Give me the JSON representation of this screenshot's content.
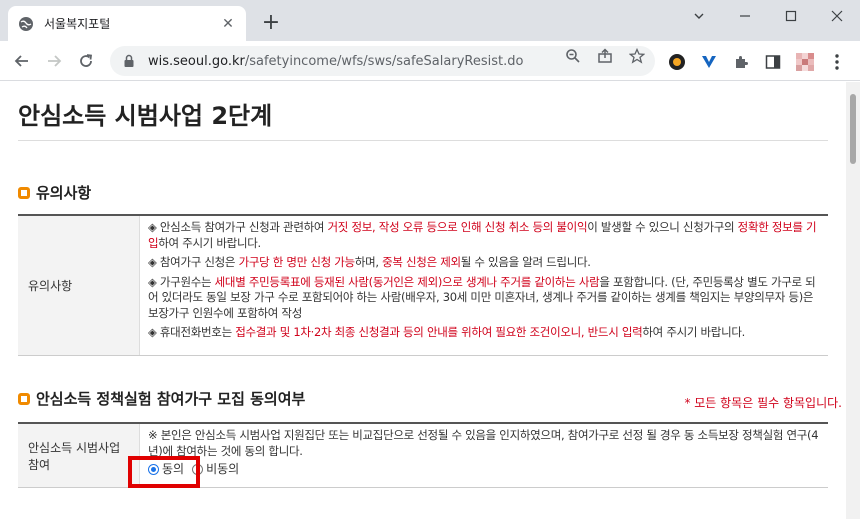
{
  "browser": {
    "tab_title": "서울복지포털",
    "new_tab_symbol": "+",
    "url_host": "wis.seoul.go.kr",
    "url_path": "/safetyincome/wfs/sws/safeSalaryResist.do"
  },
  "page": {
    "title": "안심소득 시범사업 2단계",
    "section1": {
      "heading": "유의사항",
      "row_label": "유의사항",
      "notes": [
        {
          "parts": [
            {
              "t": "◈ 안심소득 참여가구 신청과 관련하여 ",
              "red": false
            },
            {
              "t": "거짓 정보, 작성 오류 등으로 인해 신청 취소 등의 불이익",
              "red": true
            },
            {
              "t": "이 발생할 수 있으니 신청가구의 ",
              "red": false
            },
            {
              "t": "정확한 정보를 기입",
              "red": true
            },
            {
              "t": "하여 주시기 바랍니다.",
              "red": false
            }
          ]
        },
        {
          "parts": [
            {
              "t": "◈ 참여가구 신청은 ",
              "red": false
            },
            {
              "t": "가구당 한 명만 신청 가능",
              "red": true
            },
            {
              "t": "하며, ",
              "red": false
            },
            {
              "t": "중복 신청은 제외",
              "red": true
            },
            {
              "t": "될 수 있음을 알려 드립니다.",
              "red": false
            }
          ]
        },
        {
          "parts": [
            {
              "t": "◈ 가구원수는 ",
              "red": false
            },
            {
              "t": "세대별 주민등록표에 등재된 사람(동거인은 제외)으로 생계나 주거를 같이하는 사람",
              "red": true
            },
            {
              "t": "을 포함합니다. (단, 주민등록상 별도 가구로 되어 있더라도 동일 보장 가구 수로 포함되어야 하는 사람(배우자, 30세 미만 미혼자녀, 생계나 주거를 같이하는 생계를 책임지는 부양의무자 등)은 보장가구 인원수에 포함하여 작성",
              "red": false
            }
          ]
        },
        {
          "parts": [
            {
              "t": "◈ 휴대전화번호는 ",
              "red": false
            },
            {
              "t": "접수결과 및 1차·2차 최종 신청결과 등의 안내를 위하여 필요한 조건이오니, 반드시 입력",
              "red": true
            },
            {
              "t": "하여 주시기 바랍니다.",
              "red": false
            }
          ]
        }
      ]
    },
    "section2": {
      "heading": "안심소득 정책실험 참여가구 모집 동의여부",
      "required_note": "* 모든 항목은 필수 항목입니다.",
      "row_label_line1": "안심소득 시범사업",
      "row_label_line2": "참여",
      "consent_text": "※ 본인은 안심소득 시범사업 지원집단 또는 비교집단으로 선정될 수 있음을 인지하였으며, 참여가구로 선정 될 경우 동 소득보장 정책실험 연구(4년)에 참여하는 것에 동의 합니다.",
      "option_agree": "동의",
      "option_disagree": "비동의",
      "selected": "동의"
    }
  },
  "colors": {
    "accent_red": "#d0021b",
    "bullet_orange": "#f08a00",
    "highlight_red": "#e00000"
  }
}
